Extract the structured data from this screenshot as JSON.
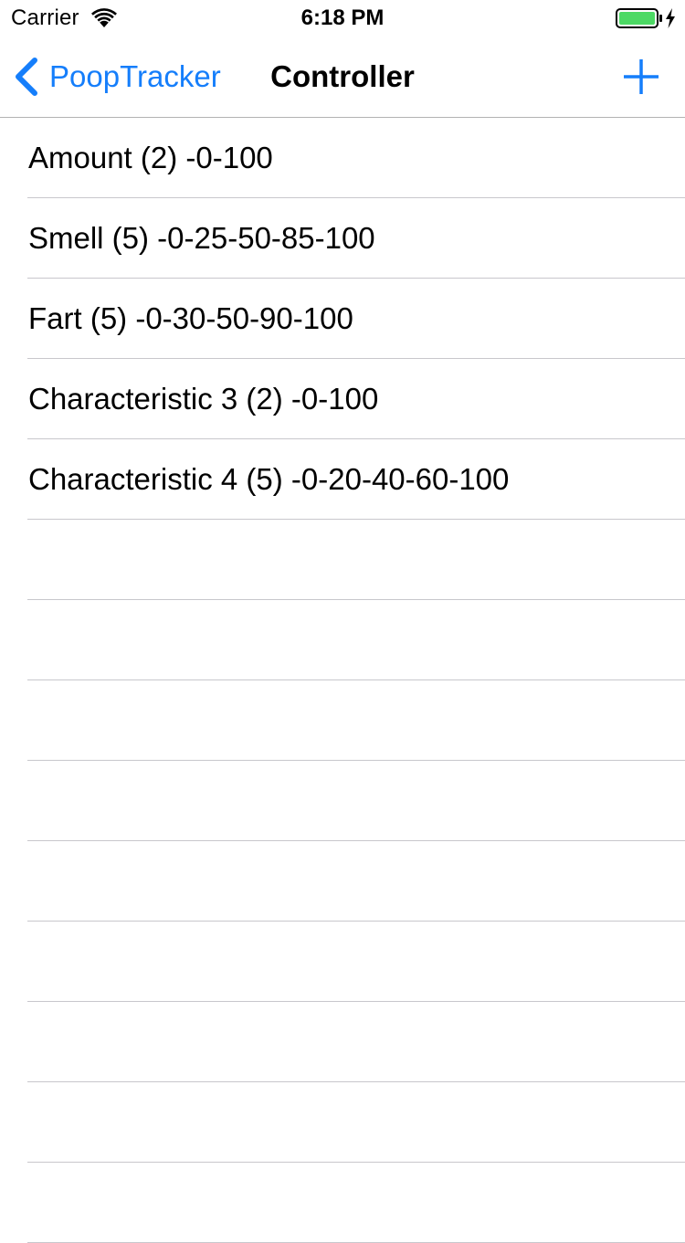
{
  "status_bar": {
    "carrier": "Carrier",
    "time": "6:18 PM",
    "battery_color": "#4cd964"
  },
  "nav": {
    "back_label": "PoopTracker",
    "title": "Controller",
    "tint_color": "#157efb"
  },
  "rows": [
    {
      "label": "Amount (2) -0-100"
    },
    {
      "label": "Smell (5) -0-25-50-85-100"
    },
    {
      "label": "Fart (5) -0-30-50-90-100"
    },
    {
      "label": "Characteristic 3 (2) -0-100"
    },
    {
      "label": "Characteristic 4 (5) -0-20-40-60-100"
    },
    {
      "label": ""
    },
    {
      "label": ""
    },
    {
      "label": ""
    },
    {
      "label": ""
    },
    {
      "label": ""
    },
    {
      "label": ""
    },
    {
      "label": ""
    },
    {
      "label": ""
    },
    {
      "label": ""
    }
  ]
}
